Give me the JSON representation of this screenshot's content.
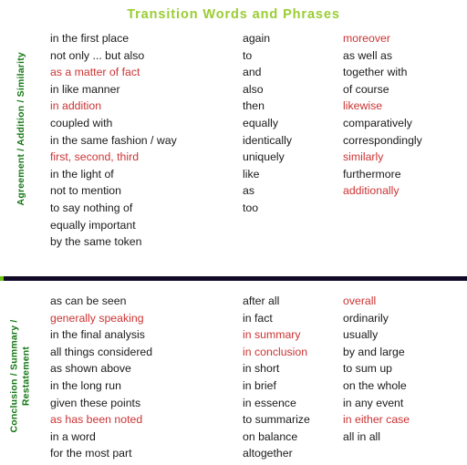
{
  "title": "Transition Words and Phrases",
  "colors": {
    "title": "#9ACD32",
    "category_label": "#117711",
    "highlight_term": "#CC3333",
    "normal_term": "#1a1a1a",
    "divider": "#110a27",
    "divider_cap": "#6cc417"
  },
  "sections": [
    {
      "label": "Agreement / Addition / Similarity",
      "columns": [
        {
          "terms": [
            {
              "text": "in the first place",
              "highlight": false
            },
            {
              "text": "not only ... but also",
              "highlight": false
            },
            {
              "text": "as a matter of fact",
              "highlight": true
            },
            {
              "text": "in like manner",
              "highlight": false
            },
            {
              "text": "in addition",
              "highlight": true
            },
            {
              "text": "coupled with",
              "highlight": false
            },
            {
              "text": "in the same fashion / way",
              "highlight": false
            },
            {
              "text": "first, second, third",
              "highlight": true
            },
            {
              "text": "in the light of",
              "highlight": false
            },
            {
              "text": "not to mention",
              "highlight": false
            },
            {
              "text": "to say nothing of",
              "highlight": false
            },
            {
              "text": "equally important",
              "highlight": false
            },
            {
              "text": "by the same token",
              "highlight": false
            }
          ]
        },
        {
          "terms": [
            {
              "text": "again",
              "highlight": false
            },
            {
              "text": "to",
              "highlight": false
            },
            {
              "text": "and",
              "highlight": false
            },
            {
              "text": "also",
              "highlight": false
            },
            {
              "text": "then",
              "highlight": false
            },
            {
              "text": "equally",
              "highlight": false
            },
            {
              "text": "identically",
              "highlight": false
            },
            {
              "text": "uniquely",
              "highlight": false
            },
            {
              "text": "like",
              "highlight": false
            },
            {
              "text": "as",
              "highlight": false
            },
            {
              "text": "too",
              "highlight": false
            }
          ]
        },
        {
          "terms": [
            {
              "text": "moreover",
              "highlight": true
            },
            {
              "text": "as well as",
              "highlight": false
            },
            {
              "text": "together with",
              "highlight": false
            },
            {
              "text": "of course",
              "highlight": false
            },
            {
              "text": "likewise",
              "highlight": true
            },
            {
              "text": "comparatively",
              "highlight": false
            },
            {
              "text": "correspondingly",
              "highlight": false
            },
            {
              "text": "similarly",
              "highlight": true
            },
            {
              "text": "furthermore",
              "highlight": false
            },
            {
              "text": "additionally",
              "highlight": true
            }
          ]
        }
      ]
    },
    {
      "label": "Conclusion / Summary /\nRestatement",
      "columns": [
        {
          "terms": [
            {
              "text": "as can be seen",
              "highlight": false
            },
            {
              "text": "generally speaking",
              "highlight": true
            },
            {
              "text": "in the final analysis",
              "highlight": false
            },
            {
              "text": "all things considered",
              "highlight": false
            },
            {
              "text": "as shown above",
              "highlight": false
            },
            {
              "text": "in the long run",
              "highlight": false
            },
            {
              "text": "given these points",
              "highlight": false
            },
            {
              "text": "as has been noted",
              "highlight": true
            },
            {
              "text": "in a word",
              "highlight": false
            },
            {
              "text": "for the most part",
              "highlight": false
            }
          ]
        },
        {
          "terms": [
            {
              "text": "after all",
              "highlight": false
            },
            {
              "text": "in fact",
              "highlight": false
            },
            {
              "text": "in summary",
              "highlight": true
            },
            {
              "text": "in conclusion",
              "highlight": true
            },
            {
              "text": "in short",
              "highlight": false
            },
            {
              "text": "in brief",
              "highlight": false
            },
            {
              "text": "in essence",
              "highlight": false
            },
            {
              "text": "to summarize",
              "highlight": false
            },
            {
              "text": "on balance",
              "highlight": false
            },
            {
              "text": "altogether",
              "highlight": false
            }
          ]
        },
        {
          "terms": [
            {
              "text": "overall",
              "highlight": true
            },
            {
              "text": "ordinarily",
              "highlight": false
            },
            {
              "text": "usually",
              "highlight": false
            },
            {
              "text": "by and large",
              "highlight": false
            },
            {
              "text": "to sum up",
              "highlight": false
            },
            {
              "text": "on the whole",
              "highlight": false
            },
            {
              "text": "in any event",
              "highlight": false
            },
            {
              "text": "in either case",
              "highlight": true
            },
            {
              "text": "all in all",
              "highlight": false
            }
          ]
        }
      ]
    }
  ]
}
